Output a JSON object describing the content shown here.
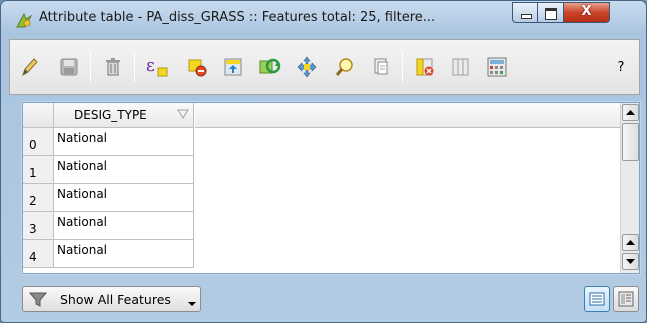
{
  "window": {
    "title": "Attribute table - PA_diss_GRASS :: Features total: 25, filtere...",
    "controls": {
      "close_label": "X"
    }
  },
  "toolbar": {
    "buttons": [
      {
        "icon": "pencil-edit-icon"
      },
      {
        "icon": "save-edits-icon"
      },
      {
        "icon": "delete-selected-icon"
      },
      {
        "icon": "select-by-expression-icon"
      },
      {
        "icon": "deselect-all-icon"
      },
      {
        "icon": "move-selection-to-top-icon"
      },
      {
        "icon": "invert-selection-icon"
      },
      {
        "icon": "pan-map-to-selection-icon"
      },
      {
        "icon": "zoom-map-to-selection-icon"
      },
      {
        "icon": "copy-rows-icon"
      },
      {
        "icon": "delete-column-icon"
      },
      {
        "icon": "new-column-icon"
      },
      {
        "icon": "field-calculator-icon"
      }
    ],
    "help_label": "?"
  },
  "table": {
    "column_header": "DESIG_TYPE",
    "rows": [
      {
        "index": "0",
        "value": "National"
      },
      {
        "index": "1",
        "value": "National"
      },
      {
        "index": "2",
        "value": "National"
      },
      {
        "index": "3",
        "value": "National"
      },
      {
        "index": "4",
        "value": "National"
      }
    ]
  },
  "footer": {
    "filter_button_label": "Show All Features"
  },
  "colors": {
    "window_frame": "#a9c4df",
    "close_button": "#c9452a",
    "table_border": "#7ea2c8"
  }
}
